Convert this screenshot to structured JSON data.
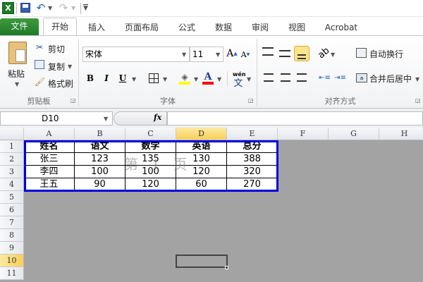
{
  "qat": {
    "icons": [
      "excel-icon",
      "save-icon",
      "undo-icon",
      "redo-icon",
      "customize-icon"
    ]
  },
  "tabs": [
    "文件",
    "开始",
    "插入",
    "页面布局",
    "公式",
    "数据",
    "审阅",
    "视图",
    "Acrobat"
  ],
  "ribbon": {
    "clipboard": {
      "paste": "粘贴",
      "cut": "剪切",
      "copy": "复制",
      "format_painter": "格式刷",
      "label": "剪贴板"
    },
    "font": {
      "name": "宋体",
      "size": "11",
      "bold": "B",
      "italic": "I",
      "underline": "U",
      "label": "字体",
      "phonetic": "wén"
    },
    "alignment": {
      "wrap_text": "自动换行",
      "merge_center": "合并后居中",
      "label": "对齐方式"
    },
    "colors": {
      "highlight": "#ffff00",
      "font_color": "#ff0000",
      "selected_btn": "#fde58a"
    }
  },
  "formula_bar": {
    "name_box": "D10",
    "fx": "fx",
    "value": ""
  },
  "sheet": {
    "columns": [
      "A",
      "B",
      "C",
      "D",
      "E",
      "F",
      "G",
      "H"
    ],
    "selected_column": "D",
    "selected_row": "10",
    "selected_cell": "D10",
    "rows": [
      "1",
      "2",
      "3",
      "4",
      "5",
      "6",
      "7",
      "8",
      "9",
      "10",
      "11"
    ],
    "table": [
      [
        "姓名",
        "语文",
        "数学",
        "英语",
        "总分"
      ],
      [
        "张三",
        "123",
        "135",
        "130",
        "388"
      ],
      [
        "李四",
        "100",
        "100",
        "120",
        "320"
      ],
      [
        "王五",
        "90",
        "120",
        "60",
        "270"
      ]
    ],
    "page_watermark": "第 1 页",
    "print_area_color": "#0000dd"
  }
}
